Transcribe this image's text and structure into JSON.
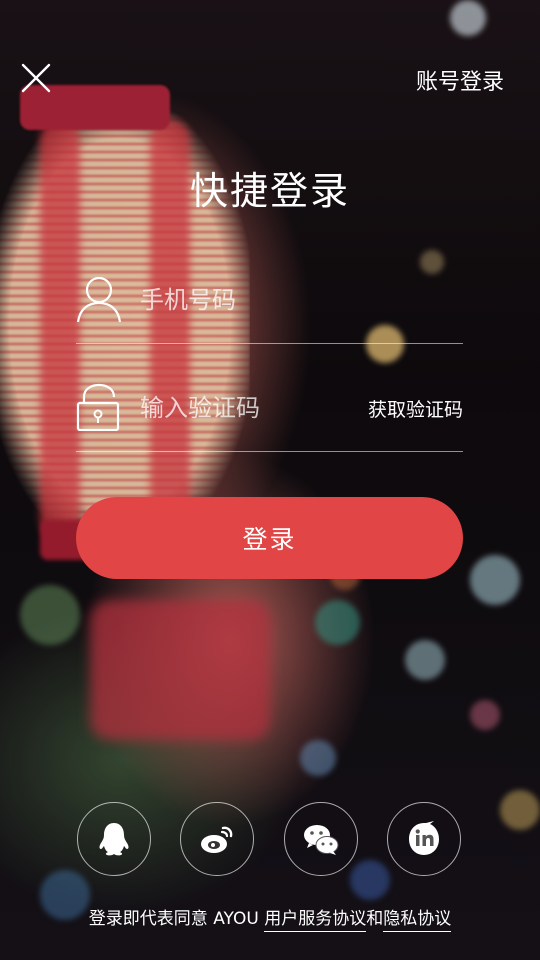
{
  "header": {
    "account_login": "账号登录",
    "close_icon": "close-icon"
  },
  "title": "快捷登录",
  "form": {
    "phone_placeholder": "手机号码",
    "phone_value": "",
    "code_placeholder": "输入验证码",
    "code_value": "",
    "get_code": "获取验证码"
  },
  "login_button": "登录",
  "social": [
    {
      "name": "qq",
      "icon": "qq-icon"
    },
    {
      "name": "weibo",
      "icon": "weibo-icon"
    },
    {
      "name": "wechat",
      "icon": "wechat-icon"
    },
    {
      "name": "linkedin",
      "icon": "linkedin-icon"
    }
  ],
  "agreement": {
    "prefix": "登录即代表同意 AYOU",
    "terms": "用户服务协议",
    "and": "和",
    "privacy": "隐私协议"
  },
  "colors": {
    "accent": "#e14545",
    "text": "#ffffff"
  }
}
